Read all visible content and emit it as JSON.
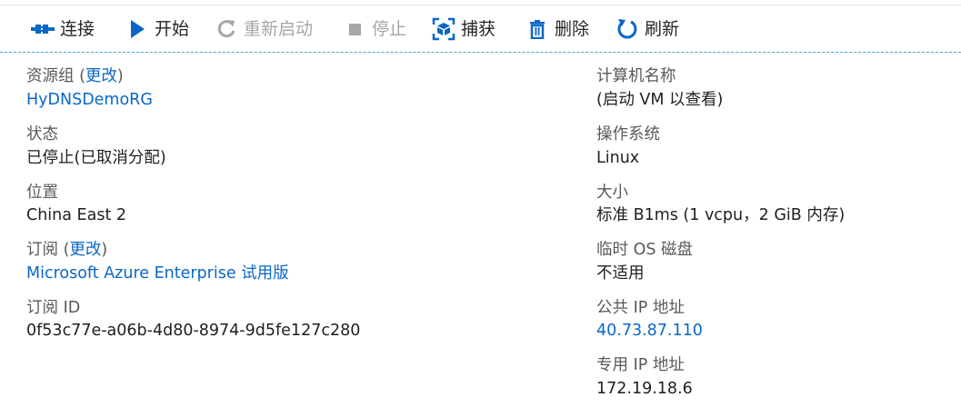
{
  "toolbar": {
    "connect": {
      "label": "连接",
      "icon": "connect-icon"
    },
    "start": {
      "label": "开始",
      "icon": "play-icon"
    },
    "restart": {
      "label": "重新启动",
      "icon": "restart-icon",
      "disabled": true
    },
    "stop": {
      "label": "停止",
      "icon": "stop-icon",
      "disabled": true
    },
    "capture": {
      "label": "捕获",
      "icon": "capture-icon"
    },
    "delete": {
      "label": "删除",
      "icon": "trash-icon"
    },
    "refresh": {
      "label": "刷新",
      "icon": "refresh-icon"
    }
  },
  "left": {
    "resource_group": {
      "label": "资源组",
      "paren_open": " (",
      "change": "更改",
      "paren_close": ")",
      "value": "HyDNSDemoRG"
    },
    "status": {
      "label": "状态",
      "value": "已停止(已取消分配)"
    },
    "location": {
      "label": "位置",
      "value": "China East 2"
    },
    "subscription": {
      "label": "订阅",
      "paren_open": " (",
      "change": "更改",
      "paren_close": ")",
      "value": "Microsoft Azure Enterprise 试用版"
    },
    "subscription_id": {
      "label": "订阅 ID",
      "value": "0f53c77e-a06b-4d80-8974-9d5fe127c280"
    }
  },
  "right": {
    "computer_name": {
      "label": "计算机名称",
      "value": "(启动 VM 以查看)"
    },
    "os": {
      "label": "操作系统",
      "value": "Linux"
    },
    "size": {
      "label": "大小",
      "value": "标准 B1ms (1 vcpu，2 GiB 内存)"
    },
    "temp_disk": {
      "label": "临时 OS 磁盘",
      "value": "不适用"
    },
    "public_ip": {
      "label": "公共 IP 地址",
      "value": "40.73.87.110"
    },
    "private_ip": {
      "label": "专用 IP 地址",
      "value": "172.19.18.6"
    }
  },
  "colors": {
    "accent": "#0a67c7",
    "disabled": "#a6a6a6",
    "divider": "#4aa3df"
  }
}
